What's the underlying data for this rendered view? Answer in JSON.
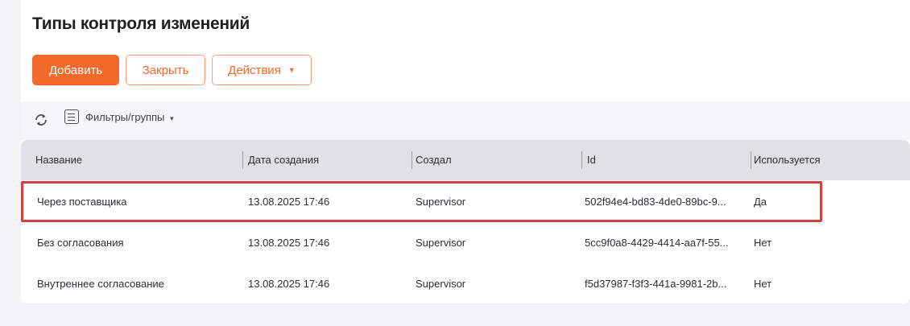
{
  "page": {
    "title": "Типы контроля изменений"
  },
  "toolbar": {
    "add_label": "Добавить",
    "close_label": "Закрыть",
    "actions_label": "Действия",
    "filters_label": "Фильтры/группы"
  },
  "table": {
    "columns": [
      "Название",
      "Дата создания",
      "Создал",
      "Id",
      "Используется"
    ],
    "rows": [
      {
        "name": "Через поставщика",
        "created": "13.08.2025 17:46",
        "author": "Supervisor",
        "id": "502f94e4-bd83-4de0-89bc-9...",
        "used": "Да",
        "selected": true
      },
      {
        "name": "Без согласования",
        "created": "13.08.2025 17:46",
        "author": "Supervisor",
        "id": "5cc9f0a8-4429-4414-aa7f-55...",
        "used": "Нет",
        "selected": false
      },
      {
        "name": "Внутреннее согласование",
        "created": "13.08.2025 17:46",
        "author": "Supervisor",
        "id": "f5d37987-f3f3-441a-9981-2b...",
        "used": "Нет",
        "selected": false
      }
    ]
  },
  "colors": {
    "accent": "#f26a2b",
    "highlight_border": "#c8463f",
    "header_bg": "#dfe1e6"
  },
  "icons": [
    "refresh-icon",
    "filter-list-icon",
    "chevron-down-icon"
  ]
}
